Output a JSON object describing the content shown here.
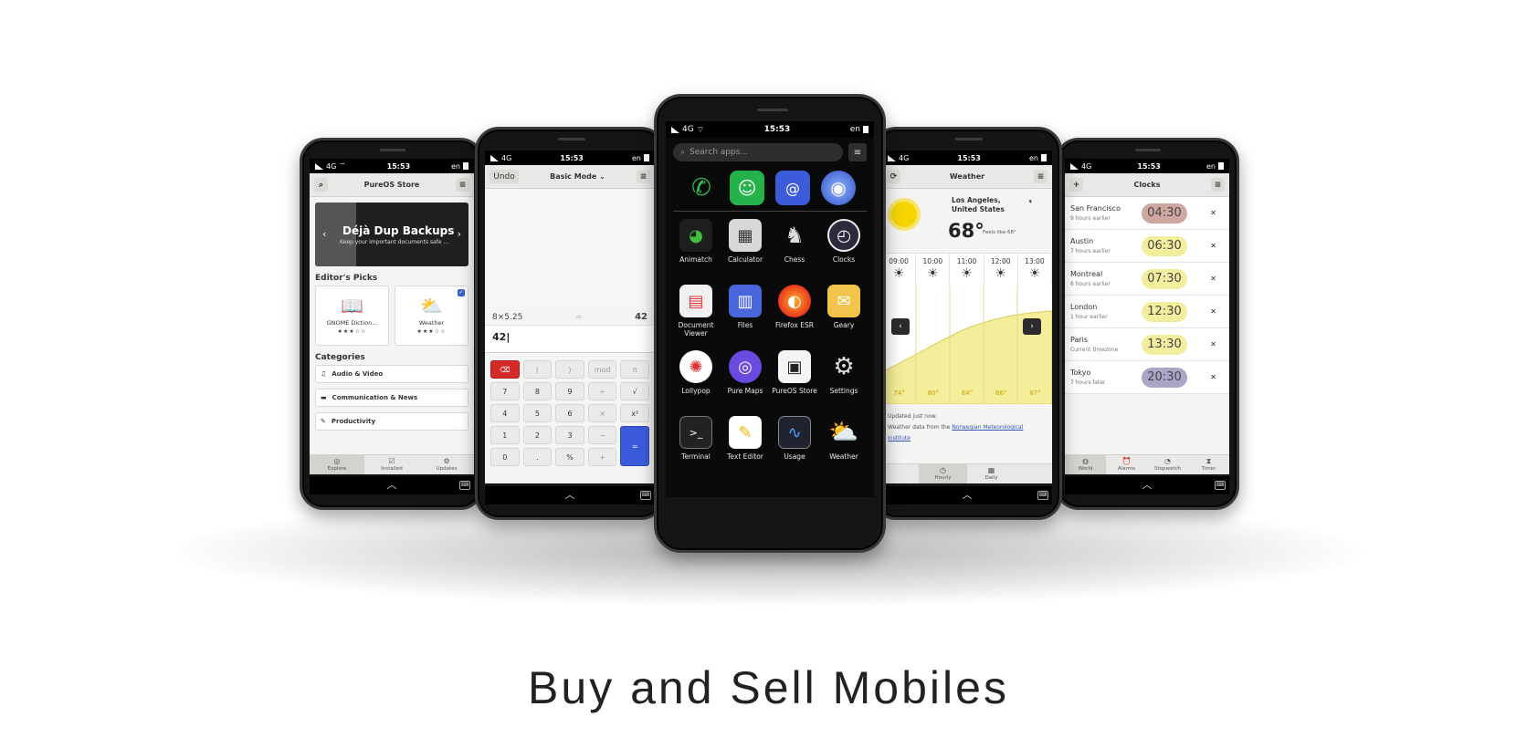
{
  "title": "Buy and Sell Mobiles",
  "status": {
    "network": "4G",
    "time": "15:53",
    "lang": "en"
  },
  "store": {
    "header": "PureOS Store",
    "banner_title": "Déjà Dup Backups",
    "banner_sub": "Keep your important documents safe ...",
    "section_picks": "Editor's Picks",
    "picks": [
      {
        "name": "GNOME Diction...",
        "stars": "★★★☆☆"
      },
      {
        "name": "Weather",
        "stars": "★★★☆☆"
      }
    ],
    "section_categories": "Categories",
    "categories": [
      "Audio & Video",
      "Communication & News",
      "Productivity"
    ],
    "tabs": [
      "Explore",
      "Installed",
      "Updates"
    ]
  },
  "calculator": {
    "undo": "Undo",
    "mode": "Basic Mode",
    "history_expr": "8×5.25",
    "history_eq": "=",
    "history_result": "42",
    "input": "42",
    "keys": [
      "(",
      ")",
      "mod",
      "π",
      "7",
      "8",
      "9",
      "÷",
      "√",
      "4",
      "5",
      "6",
      "×",
      "x²",
      "1",
      "2",
      "3",
      "−",
      "=",
      "0",
      ".",
      "%",
      "+"
    ]
  },
  "launcher": {
    "search_placeholder": "Search apps...",
    "apps": [
      "Animatch",
      "Calculator",
      "Chess",
      "Clocks",
      "Document Viewer",
      "Files",
      "Firefox ESR",
      "Geary",
      "Lollypop",
      "Pure Maps",
      "PureOS Store",
      "Settings",
      "Terminal",
      "Text Editor",
      "Usage",
      "Weather"
    ]
  },
  "weather": {
    "header": "Weather",
    "location": "Los Angeles, United States",
    "temp": "68°",
    "feels": "Feels like 68°",
    "hours": [
      "09:00",
      "10:00",
      "11:00",
      "12:00",
      "13:00"
    ],
    "temps": [
      "74°",
      "80°",
      "84°",
      "86°",
      "87°"
    ],
    "updated": "Updated just now.",
    "source_prefix": "Weather data from the",
    "source_link": "Norwegian Meteorological Institute",
    "tabs": [
      "Hourly",
      "Daily"
    ]
  },
  "clocks": {
    "header": "Clocks",
    "rows": [
      {
        "city": "San Francisco",
        "offset": "9 hours earlier",
        "time": "04:30",
        "color": "#cfa7a0"
      },
      {
        "city": "Austin",
        "offset": "7 hours earlier",
        "time": "06:30",
        "color": "#f2ee9d"
      },
      {
        "city": "Montreal",
        "offset": "6 hours earlier",
        "time": "07:30",
        "color": "#f2ee9d"
      },
      {
        "city": "London",
        "offset": "1 hour earlier",
        "time": "12:30",
        "color": "#f2ee9d"
      },
      {
        "city": "Paris",
        "offset": "Current timezone",
        "time": "13:30",
        "color": "#f2ee9d"
      },
      {
        "city": "Tokyo",
        "offset": "7 hours later",
        "time": "20:30",
        "color": "#a9a6c8"
      }
    ],
    "tabs": [
      "World",
      "Alarms",
      "Stopwatch",
      "Timer"
    ]
  }
}
